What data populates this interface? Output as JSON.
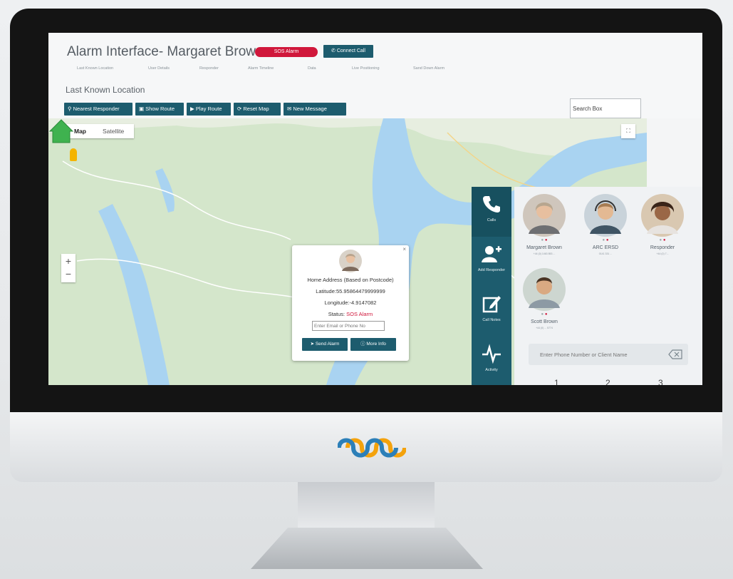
{
  "app": {
    "title": "Alarm Interface- Margaret Brown",
    "sos_badge": "SOS Alarm",
    "connect_call": "Connect Call"
  },
  "nav": {
    "items": [
      "Last Known Location",
      "User Details",
      "Responder",
      "Alarm Timeline",
      "Data",
      "Live Positioning",
      "Sand Down Alarm"
    ]
  },
  "section": {
    "title": "Last Known Location"
  },
  "toolbar": {
    "nearest_responder": "Nearest Responder",
    "show_route": "Show Route",
    "play_route": "Play Route",
    "reset_map": "Reset Map",
    "new_message": "New Message"
  },
  "search": {
    "value": "Search Box"
  },
  "map": {
    "type_map": "Map",
    "type_satellite": "Satellite",
    "zoom_in": "+",
    "zoom_out": "−"
  },
  "popup": {
    "address": "Home Address (Based on Postcode)",
    "latitude": "Latitude:55.95864479999999",
    "longitude": "Longitude:-4.9147082",
    "status_label": "Status:",
    "status_value": "SOS Alarm",
    "input_placeholder": "Enter Email or Phone No",
    "send_alarm": "Send Alarm",
    "more_info": "More Info"
  },
  "rail": {
    "items": [
      {
        "label": "Calls",
        "icon": "phone-icon"
      },
      {
        "label": "Add Responder",
        "icon": "add-user-icon"
      },
      {
        "label": "Call Notes",
        "icon": "edit-icon"
      },
      {
        "label": "Activity",
        "icon": "activity-icon"
      }
    ]
  },
  "contacts": [
    {
      "name": "Margaret Brown",
      "phone": "+44 (0) 1463 853 ..."
    },
    {
      "name": "ARC ERSD",
      "phone": "0141 331 ..."
    },
    {
      "name": "Responder",
      "phone": "+44 (0) 7..."
    },
    {
      "name": "Scott Brown",
      "phone": "+44 (0) ... 5774"
    }
  ],
  "dialer": {
    "placeholder": "Enter Phone Number or Client Name",
    "keys": [
      "1",
      "2",
      "3"
    ]
  },
  "colors": {
    "brand": "#1d5c6e",
    "alarm": "#d0173b"
  }
}
